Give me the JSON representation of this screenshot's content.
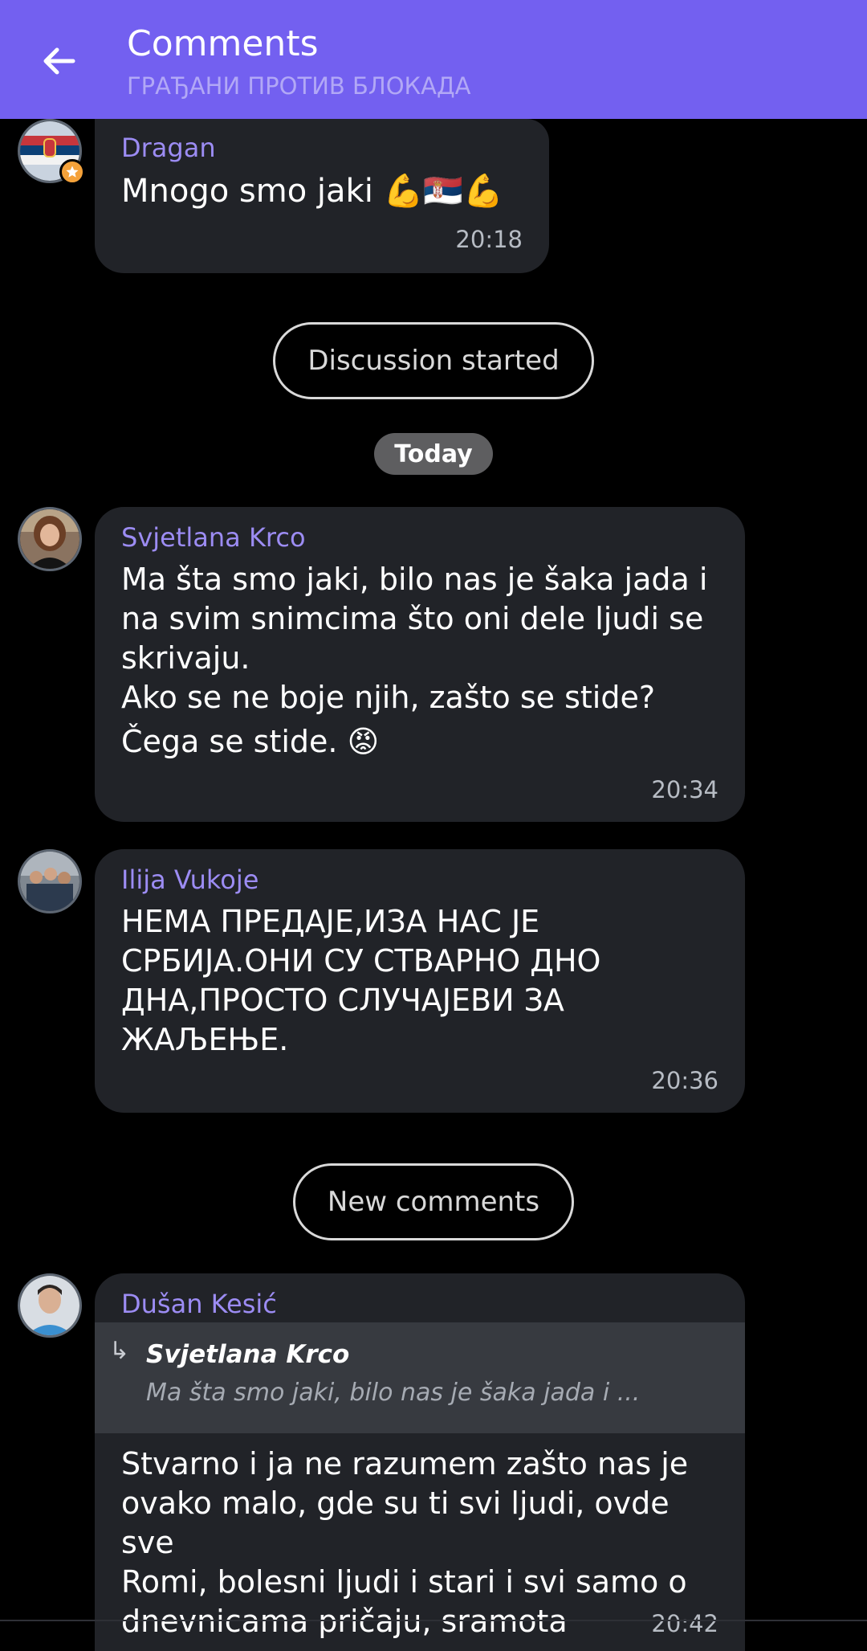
{
  "header": {
    "title": "Comments",
    "subtitle": "ГРАЂАНИ ПРОТИВ БЛОКАДА",
    "back_icon": "arrow-left-icon"
  },
  "colors": {
    "header_bg": "#7360f0",
    "bubble_bg": "#212328",
    "author_name": "#9c8cf3",
    "page_bg": "#000000",
    "admin_badge": "#f5a23a"
  },
  "comments": [
    {
      "author": "Dragan",
      "text": "Mnogo smo jaki 💪🇷🇸💪",
      "time": "20:18",
      "admin_badge": "star-icon"
    },
    {
      "author": "Svjetlana Krco",
      "text_lines": [
        "Ma šta smo jaki, bilo nas je šaka jada i",
        "na svim snimcima što oni dele ljudi se",
        "skrivaju.",
        "Ako se ne boje njih, zašto se stide?",
        "Čega se stide. 😡"
      ],
      "time": "20:34"
    },
    {
      "author": "Ilija Vukoje",
      "text_lines": [
        "НЕМА ПРЕДАЈЕ,ИЗА НАС ЈЕ",
        "СРБИЈА.ОНИ СУ СТВАРНО ДНО",
        "ДНА,ПРОСТО СЛУЧАЈЕВИ ЗА",
        "ЖАЉЕЊЕ."
      ],
      "time": "20:36"
    },
    {
      "author": "Dušan Kesić",
      "reply_to": {
        "author": "Svjetlana Krco",
        "text": "Ma šta smo jaki, bilo nas je šaka jada i ..."
      },
      "text_lines": [
        "Stvarno i ja ne razumem zašto nas je",
        "ovako malo, gde su ti svi ljudi, ovde sve",
        "Romi, bolesni ljudi i stari i svi samo o",
        "dnevnicama pričaju, sramota"
      ],
      "time": "20:42"
    }
  ],
  "separators": {
    "discussion_started": "Discussion started",
    "date_label": "Today",
    "new_comments": "New comments"
  }
}
